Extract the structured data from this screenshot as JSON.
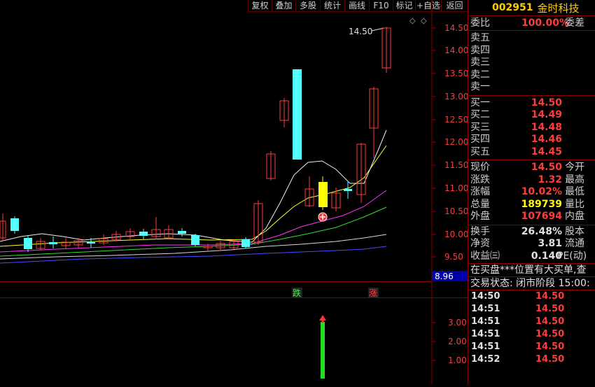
{
  "toolbar": [
    "复权",
    "叠加",
    "多股",
    "统计",
    "画线",
    "F10",
    "标记",
    "+自选",
    "返回"
  ],
  "chart": {
    "max_label": "14.50",
    "price_labels": [
      "14.50",
      "14.00",
      "13.50",
      "13.00",
      "12.50",
      "12.00",
      "11.50",
      "11.00",
      "10.50",
      "10.00",
      "9.50"
    ],
    "current_price_tag": "8.96",
    "die_label": "跌",
    "zhang_label": "涨",
    "sub_labels": [
      "3.00",
      "2.00",
      "1.00"
    ]
  },
  "panel": {
    "code": "002951",
    "name": "金时科技",
    "weibi": {
      "label": "委比",
      "value": "100.00%",
      "label2": "委差"
    },
    "sell": [
      "卖五",
      "卖四",
      "卖三",
      "卖二",
      "卖一"
    ],
    "buy": [
      {
        "label": "买一",
        "price": "14.50"
      },
      {
        "label": "买二",
        "price": "14.49"
      },
      {
        "label": "买三",
        "price": "14.48"
      },
      {
        "label": "买四",
        "price": "14.46"
      },
      {
        "label": "买五",
        "price": "14.45"
      }
    ],
    "stats": [
      {
        "label": "现价",
        "value": "14.50",
        "label2": "今开",
        "cls": "red"
      },
      {
        "label": "涨跌",
        "value": "1.32",
        "label2": "最高",
        "cls": "red"
      },
      {
        "label": "涨幅",
        "value": "10.02%",
        "label2": "最低",
        "cls": "red"
      },
      {
        "label": "总量",
        "value": "189739",
        "label2": "量比",
        "cls": "yel"
      },
      {
        "label": "外盘",
        "value": "107694",
        "label2": "内盘",
        "cls": "red"
      }
    ],
    "stats2": [
      {
        "label": "换手",
        "value": "26.48%",
        "label2": "股本",
        "cls": "wht"
      },
      {
        "label": "净资",
        "value": "3.81",
        "label2": "流通",
        "cls": "wht"
      },
      {
        "label": "收益㈢",
        "value": "0.140",
        "label2": "PE(动)",
        "cls": "wht"
      }
    ],
    "ticker1": "在买盘***位置有大买单,查",
    "ticker2": "交易状态: 闭市阶段 15:00:",
    "trades": [
      {
        "time": "14:50",
        "price": "14.50"
      },
      {
        "time": "14:51",
        "price": "14.50"
      },
      {
        "time": "14:51",
        "price": "14.50"
      },
      {
        "time": "14:51",
        "price": "14.50"
      },
      {
        "time": "14:51",
        "price": "14.50"
      },
      {
        "time": "14:52",
        "price": "14.50"
      }
    ]
  }
}
